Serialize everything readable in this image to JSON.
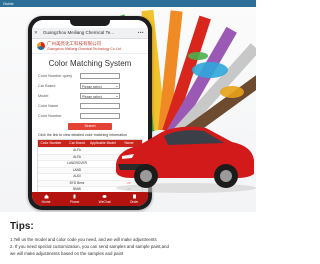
{
  "banner": {
    "caption": "Guide"
  },
  "phone": {
    "url_title": "Guangzhou Meiliang Chemical Te...",
    "brand_cn": "广州美亮化工科技有限公司",
    "brand_en": "Guangzhou Meiliang Chemical Technology Co.,Ltd",
    "app_title": "Color Matching System",
    "form": [
      {
        "label": "Color Number query",
        "value": "",
        "type": "input"
      },
      {
        "label": "Car Brand",
        "value": "Please select",
        "type": "select"
      },
      {
        "label": "Model",
        "value": "Please select",
        "type": "select"
      },
      {
        "label": "Color Name",
        "value": "",
        "type": "input"
      },
      {
        "label": "Color Number",
        "value": "",
        "type": "input"
      }
    ],
    "search_button": "Search",
    "hint": "Click the link to view detailed color matching information",
    "table": {
      "headers": [
        "Color Number",
        "Car Brand",
        "Applicable Models",
        "Name"
      ],
      "rows": [
        [
          "",
          "ALFA",
          "",
          ">>"
        ],
        [
          "",
          "ALFA",
          "",
          ">>"
        ],
        [
          "",
          "LANDROVER",
          "",
          ">>"
        ],
        [
          "",
          "LAND",
          "",
          ">>"
        ],
        [
          "",
          "AUDI",
          "",
          ">>"
        ],
        [
          "",
          "BYD Benz",
          "",
          ">>"
        ],
        [
          "",
          "BMW",
          "",
          ">>"
        ],
        [
          "",
          "SAIC",
          "",
          ">>"
        ]
      ]
    },
    "tabbar": [
      {
        "label": "Home",
        "icon": "home-icon"
      },
      {
        "label": "Phone",
        "icon": "phone-icon"
      },
      {
        "label": "WeChat",
        "icon": "wechat-icon"
      },
      {
        "label": "Order",
        "icon": "order-icon"
      }
    ]
  },
  "tips": {
    "title": "Tips:",
    "lines": [
      "1.Tell us the model and color code you need, and we will make adjustments",
      "2. If you need special customization, you can send samples and sample paint,and",
      "we will make adjustments based on the samples and paint"
    ]
  },
  "colors": {
    "accent": "#c9231a",
    "brand_blue": "#2b6f99",
    "car": "#d21a1a"
  }
}
